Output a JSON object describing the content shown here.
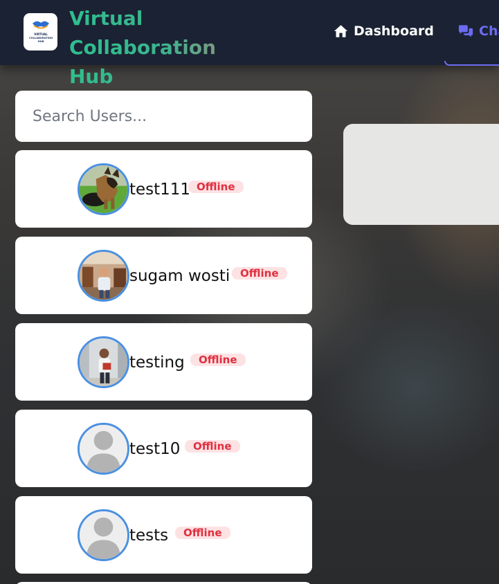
{
  "header": {
    "brand_line1": "Virtual Collaboration",
    "brand_line2": "Hub",
    "logo_icon": "handshake-logo",
    "logo_text_line1": "VIRTUAL",
    "logo_text_line2": "COLLABORATION",
    "logo_text_line3": "HUB",
    "nav": {
      "dashboard": {
        "label": "Dashboard",
        "icon": "home-icon"
      },
      "chat": {
        "label": "Chat",
        "icon": "chat-icon"
      }
    },
    "active_color": "#6b6cf2"
  },
  "search": {
    "placeholder": "Search Users..."
  },
  "users": [
    {
      "name": "test111",
      "status": "Offline",
      "avatar": "dog-photo"
    },
    {
      "name": "sugam wosti",
      "status": "Offline",
      "avatar": "person-room-photo"
    },
    {
      "name": "testing",
      "status": "Offline",
      "avatar": "person-hallway-photo"
    },
    {
      "name": "test10",
      "status": "Offline",
      "avatar": "default-user-icon"
    },
    {
      "name": "tests",
      "status": "Offline",
      "avatar": "default-user-icon"
    }
  ],
  "colors": {
    "navbar": "#1b2233",
    "offline_text": "#e0303f",
    "offline_bg": "#fde2e4",
    "avatar_border": "#4a90e2"
  }
}
